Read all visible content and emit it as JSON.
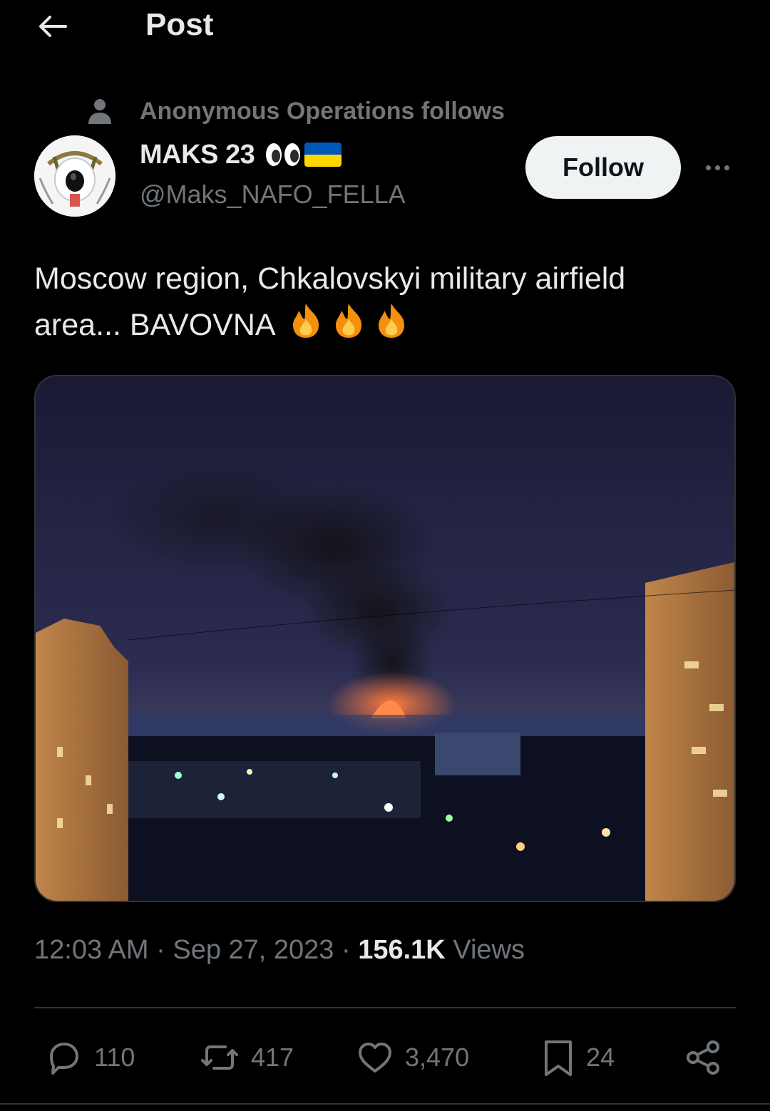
{
  "header": {
    "title": "Post"
  },
  "social_context": {
    "text": "Anonymous Operations follows"
  },
  "author": {
    "display_name": "MAKS 23",
    "handle": "@Maks_NAFO_FELLA",
    "name_emojis": [
      "eyes-emoji",
      "ukraine-flag-emoji"
    ]
  },
  "follow_button": {
    "label": "Follow"
  },
  "post": {
    "text_line1": "Moscow region, Chkalovskyi military airfield",
    "text_line2": "area... BAVOVNA",
    "trailing_emojis": [
      "fire-emoji",
      "fire-emoji",
      "fire-emoji"
    ]
  },
  "meta": {
    "time": "12:03 AM",
    "sep1": "·",
    "date": "Sep 27, 2023",
    "sep2": "·",
    "views_count": "156.1K",
    "views_label": "Views"
  },
  "actions": {
    "replies": "110",
    "reposts": "417",
    "likes": "3,470",
    "bookmarks": "24"
  },
  "colors": {
    "background": "#000000",
    "text_primary": "#e7e9ea",
    "text_secondary": "#71767b",
    "follow_bg": "#eff3f4",
    "divider": "#2f3336",
    "flag_blue": "#0057b7",
    "flag_yellow": "#ffd700"
  }
}
